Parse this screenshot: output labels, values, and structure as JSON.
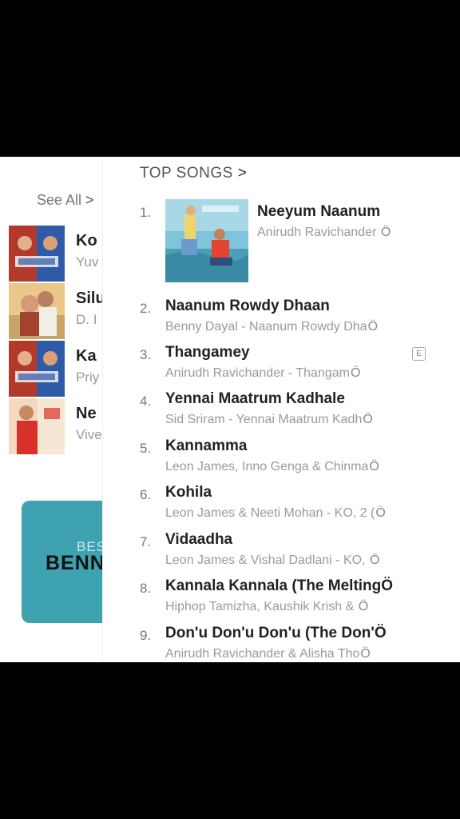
{
  "left_panel": {
    "see_all": "See All",
    "see_all_chevron": ">",
    "albums": [
      {
        "title": "Ko",
        "artist": "Yuv",
        "art_icon": "album-cover-ko2"
      },
      {
        "title": "Silu",
        "artist": "D. I",
        "art_icon": "album-cover-couple"
      },
      {
        "title": "Ka",
        "artist": "Priy",
        "art_icon": "album-cover-ko2"
      },
      {
        "title": "Ne",
        "artist": "Vive",
        "art_icon": "album-cover-red-shirt"
      }
    ],
    "banner": {
      "small": "BES",
      "big": "BENN",
      "color": "#3fa2b1"
    }
  },
  "top_songs": {
    "title": "TOP SONGS",
    "chevron": ">",
    "more_glyph": "Ö",
    "explicit_badge": "E",
    "songs": [
      {
        "rank": "1.",
        "title": "Neeyum Naanum",
        "subtitle": "Anirudh Ravichander"
      },
      {
        "rank": "2.",
        "title": "Naanum Rowdy Dhaan",
        "subtitle": "Benny Dayal - Naanum Rowdy Dha"
      },
      {
        "rank": "3.",
        "title": "Thangamey",
        "subtitle": "Anirudh Ravichander - Thangam"
      },
      {
        "rank": "4.",
        "title": "Yennai Maatrum Kadhale",
        "subtitle": "Sid Sriram - Yennai Maatrum Kadh"
      },
      {
        "rank": "5.",
        "title": "Kannamma",
        "subtitle": "Leon James, Inno Genga & Chinma"
      },
      {
        "rank": "6.",
        "title": "Kohila",
        "subtitle": "Leon James & Neeti Mohan - KO, 2 ("
      },
      {
        "rank": "7.",
        "title": "Vidaadha",
        "subtitle": "Leon James & Vishal Dadlani - KO,"
      },
      {
        "rank": "8.",
        "title": "Kannala Kannala (The Melting",
        "subtitle": "Hiphop Tamizha, Kaushik Krish &"
      },
      {
        "rank": "9.",
        "title": "Don'u Don'u Don'u (The Don'",
        "subtitle": "Anirudh Ravichander & Alisha Tho"
      }
    ]
  }
}
